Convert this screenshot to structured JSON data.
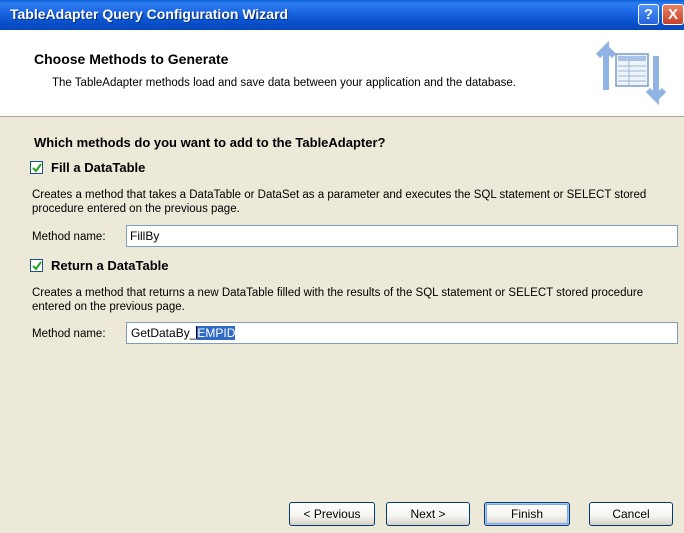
{
  "window": {
    "title": "TableAdapter Query Configuration Wizard",
    "help_label": "?",
    "close_label": "X"
  },
  "header": {
    "title": "Choose Methods to Generate",
    "description": "The TableAdapter methods load and save data between your application and the database."
  },
  "question": "Which methods do you want to add to the TableAdapter?",
  "fill": {
    "label": "Fill a DataTable",
    "checked": true,
    "description": "Creates a method that takes a DataTable or DataSet as a parameter and executes the SQL statement or SELECT stored procedure entered on the previous page.",
    "method_label": "Method name:",
    "method_value": "FillBy"
  },
  "return": {
    "label": "Return a DataTable",
    "checked": true,
    "description": "Creates a method that returns a new DataTable filled with the results of the SQL statement or SELECT stored procedure entered on the previous page.",
    "method_label": "Method name:",
    "method_value_prefix": "GetDataBy_",
    "method_value_selected": "EMPID"
  },
  "buttons": {
    "previous": "< Previous",
    "next": "Next >",
    "finish": "Finish",
    "cancel": "Cancel"
  },
  "colors": {
    "titlebar": "#0a53cf",
    "selection": "#316ac5",
    "face": "#ece9d8"
  }
}
